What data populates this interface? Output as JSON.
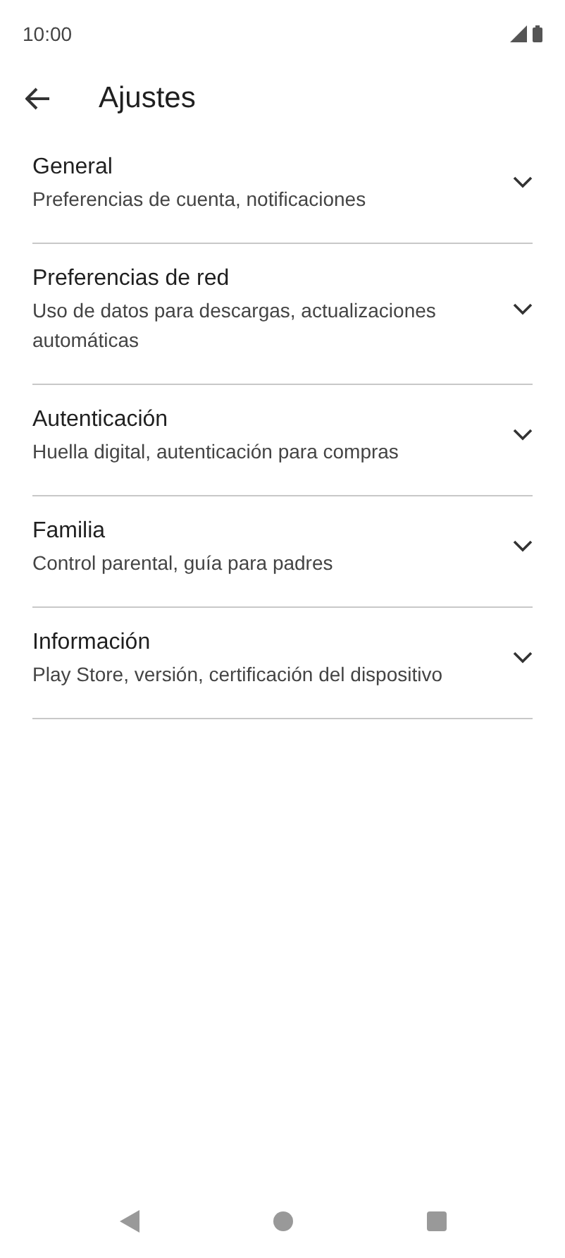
{
  "status_bar": {
    "time": "10:00"
  },
  "header": {
    "title": "Ajustes"
  },
  "sections": [
    {
      "title": "General",
      "subtitle": "Preferencias de cuenta, notificaciones",
      "expanded": false
    },
    {
      "title": "Preferencias de red",
      "subtitle": "Uso de datos para descargas, actualizaciones automáticas",
      "expanded": false
    },
    {
      "title": "Autenticación",
      "subtitle": "Huella digital, autenticación para compras",
      "expanded": false
    },
    {
      "title": "Familia",
      "subtitle": "Control parental, guía para padres",
      "expanded": false
    },
    {
      "title": "Información",
      "subtitle": "Play Store, versión, certificación del dispositivo",
      "expanded": false
    }
  ]
}
